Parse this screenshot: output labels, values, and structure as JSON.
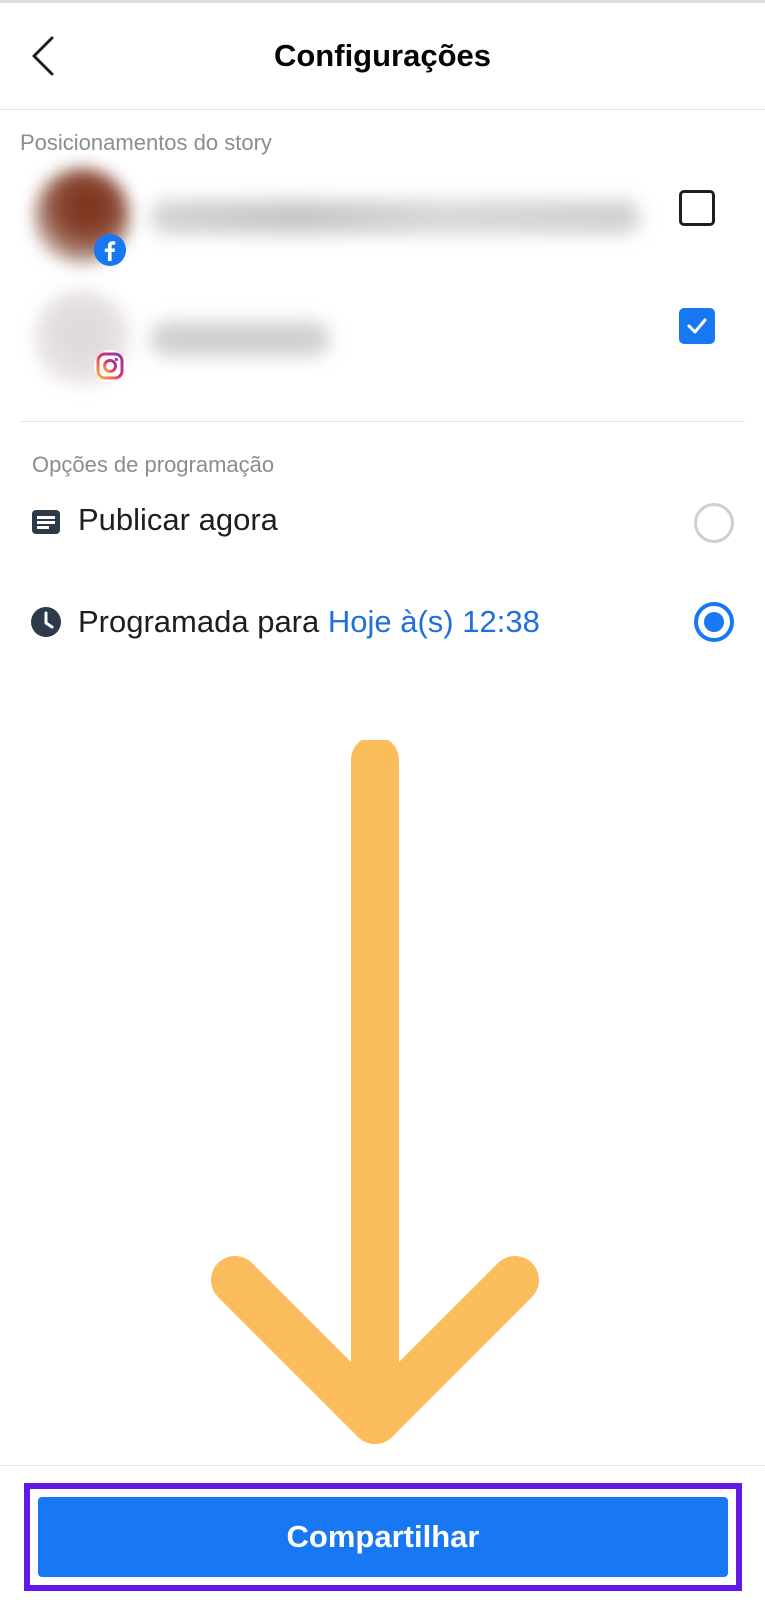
{
  "header": {
    "title": "Configurações",
    "back_icon": "chevron-left-icon"
  },
  "placements": {
    "section_label": "Posicionamentos do story",
    "accounts": [
      {
        "platform": "facebook",
        "badge_icon": "facebook-icon",
        "checked": false
      },
      {
        "platform": "instagram",
        "badge_icon": "instagram-icon",
        "checked": true
      }
    ]
  },
  "schedule": {
    "section_label": "Opções de programação",
    "options": [
      {
        "label": "Publicar agora",
        "icon": "document-icon",
        "selected": false
      },
      {
        "label": "Programada para",
        "link": "Hoje à(s) 12:38",
        "icon": "clock-icon",
        "selected": true
      }
    ]
  },
  "footer": {
    "share_label": "Compartilhar"
  },
  "colors": {
    "accent": "#1877f2",
    "link": "#216fdb",
    "annotation_arrow": "#fbbd5c",
    "annotation_highlight": "#6418e8"
  }
}
